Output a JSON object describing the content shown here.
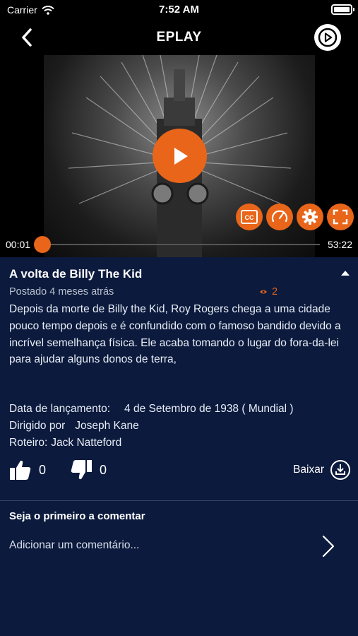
{
  "status_bar": {
    "carrier": "Carrier",
    "time": "7:52 AM"
  },
  "nav": {
    "title": "EPLAY",
    "back_icon": "chevron-left-icon",
    "play_icon": "play-circle-icon"
  },
  "player": {
    "current_time": "00:01",
    "duration": "53:22",
    "progress": 0.0003,
    "controls": [
      "cc-icon",
      "speed-icon",
      "settings-gear-icon",
      "fullscreen-icon"
    ],
    "accent": "#e8651a"
  },
  "video": {
    "title": "A volta de Billy The Kid",
    "posted": "Postado 4 meses atrás",
    "views": "2",
    "description": "Depois da morte de Billy the Kid, Roy Rogers chega a uma cidade pouco tempo depois e é confundido com o famoso bandido devido a incrível semelhança física. Ele acaba tomando o lugar do fora-da-lei para ajudar alguns donos de terra,",
    "release_label": "Data de lançamento:",
    "release_value": "4 de Setembro de 1938 ( Mundial )",
    "director_label": "Dirigido por",
    "director_value": "Joseph Kane",
    "writer_label": "Roteiro:",
    "writer_value": "Jack Natteford",
    "likes": "0",
    "dislikes": "0",
    "download_label": "Baixar"
  },
  "comments": {
    "heading": "Seja o primeiro a comentar",
    "add_placeholder": "Adicionar um comentário..."
  },
  "colors": {
    "background": "#0b1a3d",
    "accent": "#e8651a"
  }
}
